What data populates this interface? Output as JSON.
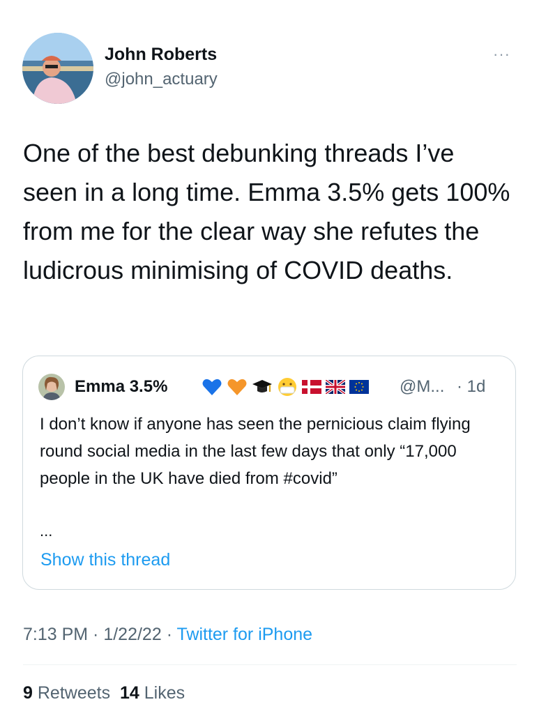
{
  "author": {
    "name": "John Roberts",
    "handle": "@john_actuary",
    "avatar_icon": "profile-photo"
  },
  "more_label": "···",
  "tweet": {
    "text": "One of the best debunking threads I’ve seen in a long time. Emma 3.5% gets 100% from me for the clear way she refutes the ludicrous minimising of COVID deaths."
  },
  "quoted": {
    "name": "Emma 3.5%",
    "emojis": [
      "blue-heart-icon",
      "orange-heart-icon",
      "graduation-cap-icon",
      "face-mask-icon",
      "denmark-flag-icon",
      "uk-flag-icon",
      "eu-flag-icon"
    ],
    "handle": "@M...",
    "time": "· 1d",
    "text": "I don’t know if anyone has seen the pernicious claim flying round social media in the last few days that only “17,000 people in the UK have died from #covid”",
    "ellipsis": "...",
    "show_thread": "Show this thread"
  },
  "meta": {
    "time": "7:13 PM",
    "sep1": " · ",
    "date": "1/22/22",
    "sep2": " · ",
    "source": "Twitter for iPhone"
  },
  "stats": {
    "retweets_count": "9",
    "retweets_label": "Retweets",
    "likes_count": "14",
    "likes_label": "Likes"
  },
  "colors": {
    "accent": "#1d9bf0",
    "secondary_text": "#536471",
    "primary_text": "#0f1419",
    "border": "#cfd9de"
  }
}
